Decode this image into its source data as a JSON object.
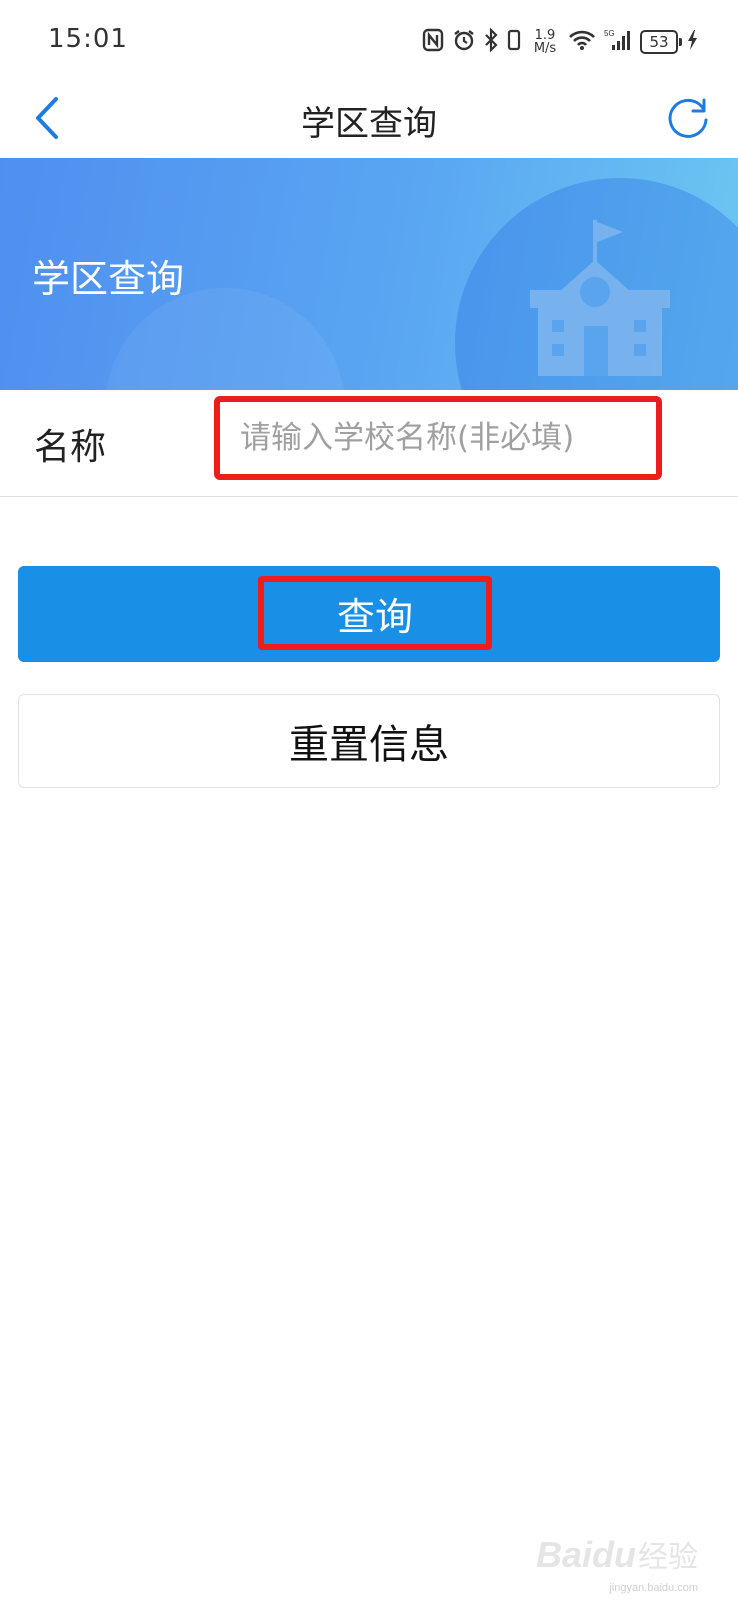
{
  "status_bar": {
    "time": "15:01",
    "net_speed_value": "1.9",
    "net_speed_unit": "M/s",
    "network_type": "5G",
    "battery": "53"
  },
  "title_bar": {
    "title": "学区查询",
    "back_icon": "chevron-left-icon",
    "refresh_icon": "refresh-icon"
  },
  "banner": {
    "title": "学区查询"
  },
  "form": {
    "name_label": "名称",
    "name_value": "",
    "name_placeholder": "请输入学校名称(非必填)"
  },
  "buttons": {
    "query_label": "查询",
    "reset_label": "重置信息"
  },
  "watermark": {
    "logo": "Baidu",
    "text": "经验",
    "url": "jingyan.baidu.com"
  },
  "colors": {
    "primary": "#1a8fe6",
    "accent_blue": "#1e7be0",
    "highlight_red": "#ee1c1c",
    "banner_start": "#4f8ff0",
    "banner_end": "#6cc7f1"
  }
}
